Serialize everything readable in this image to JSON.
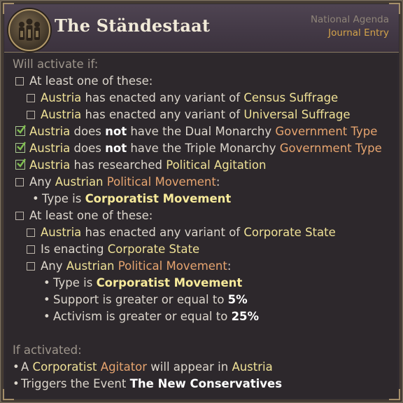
{
  "header": {
    "title": "The Ständestaat",
    "category": "National Agenda",
    "entry_type": "Journal Entry"
  },
  "conditions": {
    "heading": "Will activate if:",
    "lines": [
      {
        "id": 0,
        "parts": [
          "At least one of these:"
        ]
      },
      {
        "id": 1,
        "parts": [
          "Austria",
          " has enacted any variant of ",
          "Census Suffrage"
        ]
      },
      {
        "id": 2,
        "parts": [
          "Austria",
          " has enacted any variant of ",
          "Universal Suffrage"
        ]
      },
      {
        "id": 3,
        "parts": [
          "Austria",
          " does ",
          "not",
          " have the Dual Monarchy ",
          "Government Type"
        ]
      },
      {
        "id": 4,
        "parts": [
          "Austria",
          " does ",
          "not",
          " have the Triple Monarchy ",
          "Government Type"
        ]
      },
      {
        "id": 5,
        "parts": [
          "Austria",
          " has researched ",
          "Political Agitation"
        ]
      },
      {
        "id": 6,
        "parts": [
          "Any ",
          "Austrian",
          " ",
          "Political Movement",
          ":"
        ]
      },
      {
        "id": 7,
        "parts": [
          "Type is ",
          "Corporatist Movement"
        ]
      },
      {
        "id": 8,
        "parts": [
          "At least one of these:"
        ]
      },
      {
        "id": 9,
        "parts": [
          "Austria",
          " has enacted any variant of ",
          "Corporate State"
        ]
      },
      {
        "id": 10,
        "parts": [
          "Is enacting ",
          "Corporate State"
        ]
      },
      {
        "id": 11,
        "parts": [
          "Any ",
          "Austrian",
          " ",
          "Political Movement",
          ":"
        ]
      },
      {
        "id": 12,
        "parts": [
          "Type is ",
          "Corporatist Movement"
        ]
      },
      {
        "id": 13,
        "parts": [
          "Support is greater or equal to ",
          "5%"
        ]
      },
      {
        "id": 14,
        "parts": [
          "Activism is greater or equal to ",
          "25%"
        ]
      }
    ]
  },
  "effects": {
    "heading": "If activated:",
    "lines": [
      {
        "parts": [
          "A ",
          "Corporatist",
          " ",
          "Agitator",
          " will appear in ",
          "Austria"
        ]
      },
      {
        "parts": [
          "Triggers the Event ",
          "The New Conservatives"
        ]
      }
    ]
  },
  "colors": {
    "highlight_yellow": "#efe196",
    "highlight_orange": "#e6a46f",
    "accent_gold": "#d3a34a"
  }
}
